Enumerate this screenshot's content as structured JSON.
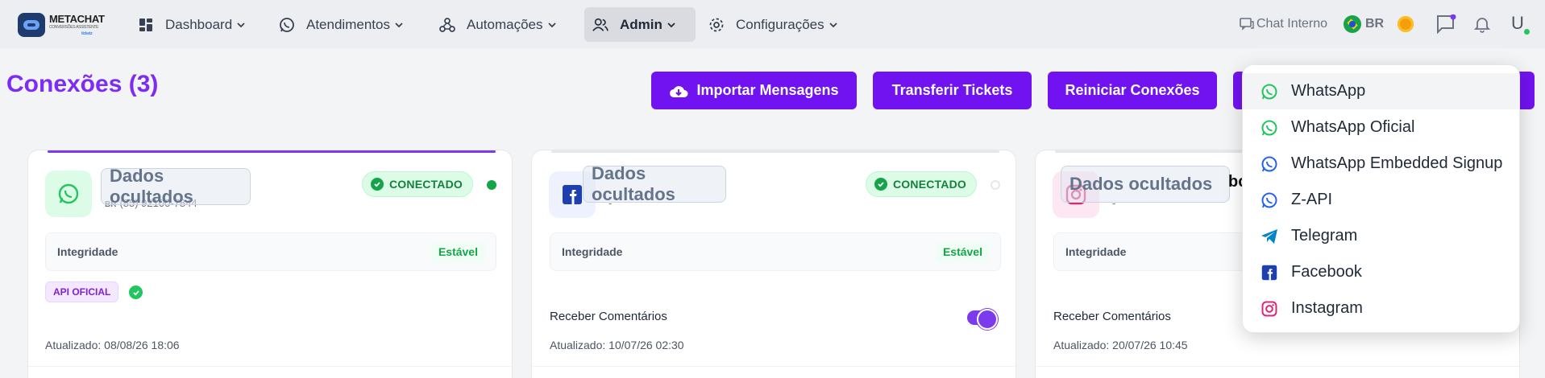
{
  "brand": {
    "name": "METACHAT",
    "tagline": "CONVERSÕES ASSISTENTE",
    "sub": "ticketz"
  },
  "nav": {
    "items": [
      {
        "label": "Dashboard",
        "icon": "dashboard-icon"
      },
      {
        "label": "Atendimentos",
        "icon": "whatsapp-icon"
      },
      {
        "label": "Automações",
        "icon": "webhook-icon"
      },
      {
        "label": "Admin",
        "icon": "users-icon",
        "active": true
      },
      {
        "label": "Configurações",
        "icon": "gear-icon"
      }
    ],
    "chat_interno": "Chat Interno",
    "language": "BR",
    "avatar_initial": "U"
  },
  "page": {
    "title": "Conexões (3)",
    "buttons": {
      "import": "Importar Mensagens",
      "transfer": "Transferir Tickets",
      "restart": "Reiniciar Conexões"
    }
  },
  "cards": [
    {
      "name": "Dados ocultados",
      "country": "BR",
      "phone": "(85) 92100-7844",
      "status": "CONECTADO",
      "integrity_label": "Integridade",
      "integrity_value": "Estável",
      "badge": "API OFICIAL",
      "updated": "Atualizado: 08/08/26 18:06"
    },
    {
      "name": "Dados ocultados",
      "phone": "-",
      "status": "CONECTADO",
      "integrity_label": "Integridade",
      "integrity_value": "Estável",
      "receive_label": "Receber Comentários",
      "updated": "Atualizado: 10/07/26 02:30"
    },
    {
      "name": "Dados ocultados",
      "name_suffix": "bc",
      "phone": "-",
      "integrity_label": "Integridade",
      "receive_label": "Receber Comentários",
      "updated": "Atualizado: 20/07/26 10:45"
    }
  ],
  "dropdown": {
    "items": [
      {
        "label": "WhatsApp",
        "icon": "whatsapp-icon",
        "color": "#22c55e"
      },
      {
        "label": "WhatsApp Oficial",
        "icon": "whatsapp-icon",
        "color": "#22c55e"
      },
      {
        "label": "WhatsApp Embedded Signup",
        "icon": "whatsapp-icon",
        "color": "#2563eb"
      },
      {
        "label": "Z-API",
        "icon": "whatsapp-icon",
        "color": "#2563eb"
      },
      {
        "label": "Telegram",
        "icon": "telegram-icon",
        "color": "#0284c7"
      },
      {
        "label": "Facebook",
        "icon": "facebook-icon",
        "color": "#1e40af"
      },
      {
        "label": "Instagram",
        "icon": "instagram-icon",
        "color": "#db2777"
      }
    ]
  },
  "colors": {
    "accent": "#7112f0",
    "title": "#7c2cf5",
    "success": "#16a34a"
  }
}
